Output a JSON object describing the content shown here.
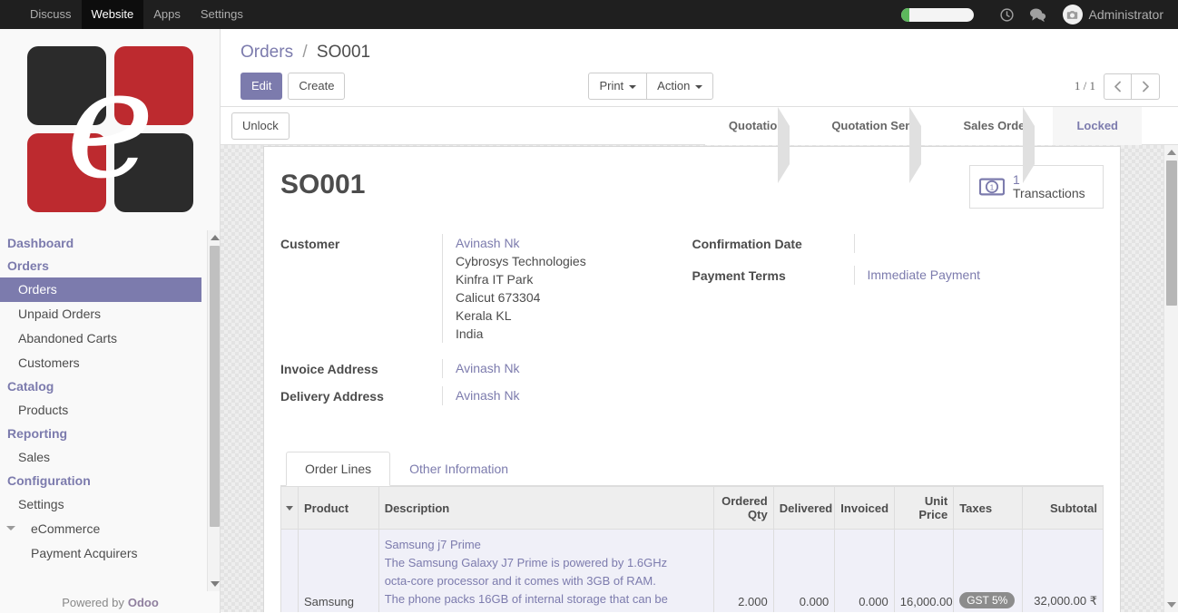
{
  "topbar": {
    "apps": [
      {
        "label": "Discuss",
        "active": false
      },
      {
        "label": "Website",
        "active": true
      },
      {
        "label": "Apps",
        "active": false
      },
      {
        "label": "Settings",
        "active": false
      }
    ],
    "systray": {
      "progress_label": "",
      "clock_icon": "clock-icon",
      "messages_icon": "chat-bubble-icon",
      "avatar_icon": "camera-avatar-icon",
      "username": "Administrator"
    }
  },
  "sidebar": {
    "logo_letter": "e",
    "sections": [
      {
        "title": "Dashboard",
        "items": []
      },
      {
        "title": "Orders",
        "items": [
          {
            "label": "Orders",
            "selected": true,
            "level": 1
          },
          {
            "label": "Unpaid Orders",
            "selected": false,
            "level": 1
          },
          {
            "label": "Abandoned Carts",
            "selected": false,
            "level": 1
          },
          {
            "label": "Customers",
            "selected": false,
            "level": 1
          }
        ]
      },
      {
        "title": "Catalog",
        "items": [
          {
            "label": "Products",
            "selected": false,
            "level": 1
          }
        ]
      },
      {
        "title": "Reporting",
        "items": [
          {
            "label": "Sales",
            "selected": false,
            "level": 1
          }
        ]
      },
      {
        "title": "Configuration",
        "items": [
          {
            "label": "Settings",
            "selected": false,
            "level": 1
          },
          {
            "label": "eCommerce",
            "selected": false,
            "level": 2
          },
          {
            "label": "Payment Acquirers",
            "selected": false,
            "level": 3
          }
        ]
      }
    ],
    "footer_prefix": "Powered by",
    "footer_brand": "Odoo"
  },
  "control_panel": {
    "breadcrumb_root": "Orders",
    "breadcrumb_sep": "/",
    "breadcrumb_current": "SO001",
    "edit_label": "Edit",
    "create_label": "Create",
    "print_label": "Print",
    "action_label": "Action",
    "pager_count": "1 / 1",
    "prev_icon": "chevron-left-icon",
    "next_icon": "chevron-right-icon"
  },
  "statusbar": {
    "unlock_label": "Unlock",
    "stages": [
      {
        "label": "Quotation",
        "active": false
      },
      {
        "label": "Quotation Sent",
        "active": false
      },
      {
        "label": "Sales Order",
        "active": false
      },
      {
        "label": "Locked",
        "active": true
      }
    ]
  },
  "record": {
    "title": "SO001",
    "stat_buttons": [
      {
        "icon": "money-banknote-icon",
        "value": "1",
        "label": "Transactions"
      }
    ],
    "left_fields": [
      {
        "label": "Customer",
        "link": "Avinash Nk",
        "address": [
          "Cybrosys Technologies",
          "Kinfra IT Park",
          "Calicut 673304",
          "Kerala KL",
          "India"
        ]
      },
      {
        "label": "Invoice Address",
        "link": "Avinash Nk",
        "address": []
      },
      {
        "label": "Delivery Address",
        "link": "Avinash Nk",
        "address": []
      }
    ],
    "right_fields": [
      {
        "label": "Confirmation Date",
        "link": "",
        "address": []
      },
      {
        "label": "Payment Terms",
        "link": "Immediate Payment",
        "address": []
      }
    ]
  },
  "notebook": {
    "tabs": [
      {
        "label": "Order Lines",
        "active": true
      },
      {
        "label": "Other Information",
        "active": false
      }
    ],
    "columns": [
      "Product",
      "Description",
      "Ordered Qty",
      "Delivered",
      "Invoiced",
      "Unit Price",
      "Taxes",
      "Subtotal"
    ],
    "rows": [
      {
        "product": "Samsung",
        "description_title": "Samsung j7 Prime",
        "description_lines": [
          "The Samsung Galaxy J7 Prime is powered by 1.6GHz",
          "octa-core processor and it comes with 3GB of RAM.",
          "The phone packs 16GB of internal storage that can be"
        ],
        "ordered_qty": "2.000",
        "delivered": "0.000",
        "invoiced": "0.000",
        "unit_price": "16,000.00",
        "taxes": "GST 5%",
        "subtotal": "32,000.00 ₹"
      }
    ]
  },
  "colors": {
    "accent": "#7c7bad",
    "navbar": "#1f1f1f",
    "logo_red": "#bd2a2f",
    "logo_black": "#2b2b2b",
    "tax_badge": "#8c8c8c",
    "progress_green": "#5cb85c"
  }
}
